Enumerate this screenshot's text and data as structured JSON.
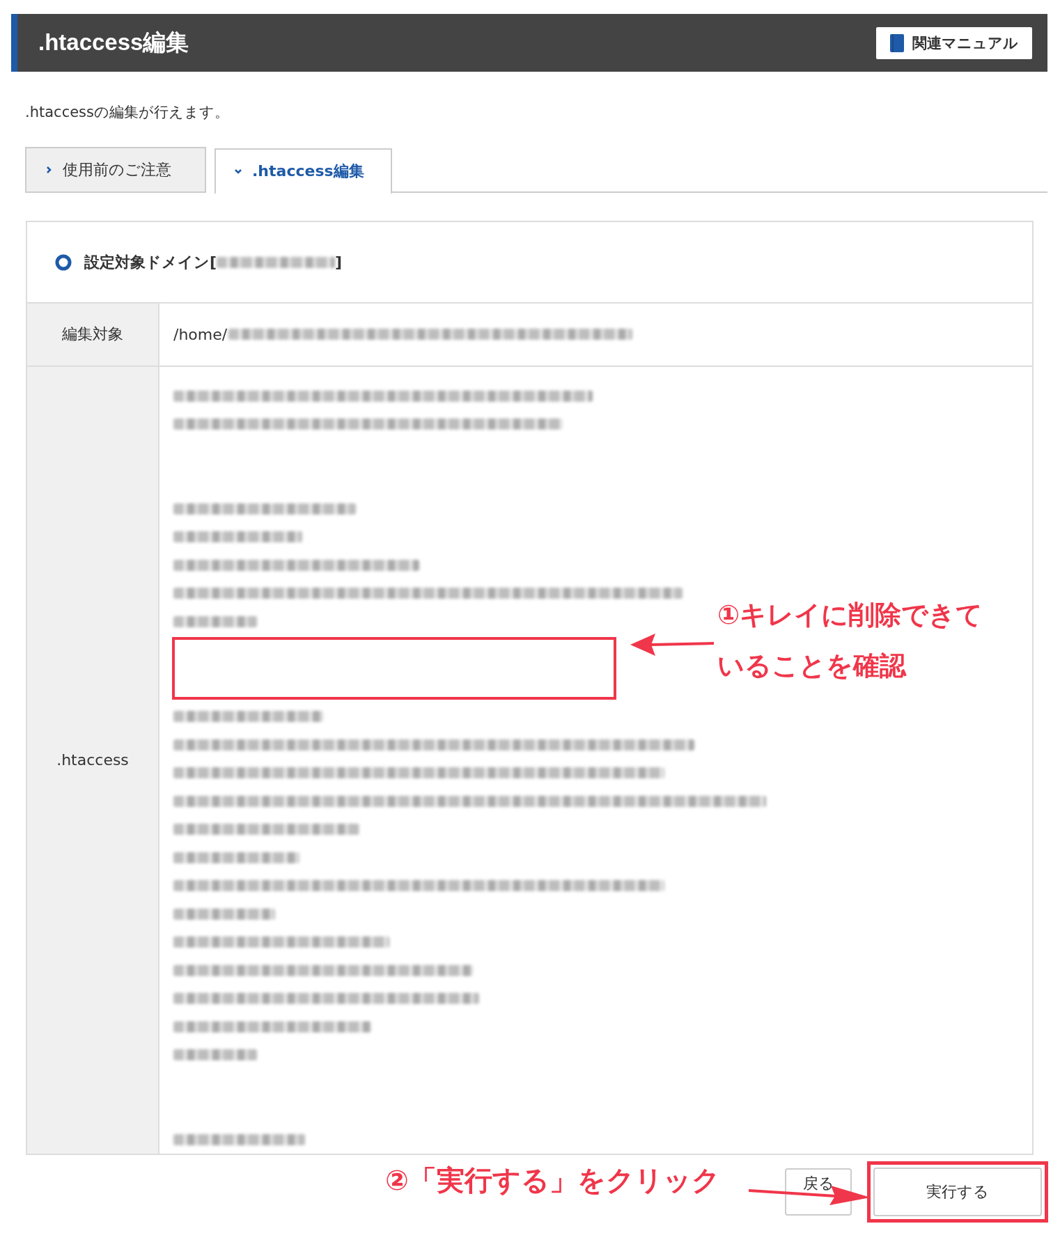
{
  "header": {
    "title": ".htaccess編集",
    "manual_button": "関連マニュアル"
  },
  "description": ".htaccessの編集が行えます。",
  "tabs": [
    {
      "label": "使用前のご注意",
      "selected": false
    },
    {
      "label": ".htaccess編集",
      "selected": true
    }
  ],
  "panel": {
    "domain_label": "設定対象ドメイン[",
    "domain_close": "]",
    "target_label": "編集対象",
    "target_value": "/home/",
    "htaccess_label": ".htaccess"
  },
  "annotations": [
    {
      "text": "①キレイに削除できて"
    },
    {
      "text": "いることを確認"
    },
    {
      "text": "②「実行する」をクリック"
    }
  ],
  "buttons": [
    {
      "label": "戻る",
      "kind": "back"
    },
    {
      "label": "実行する",
      "kind": "run",
      "highlighted": true
    }
  ]
}
